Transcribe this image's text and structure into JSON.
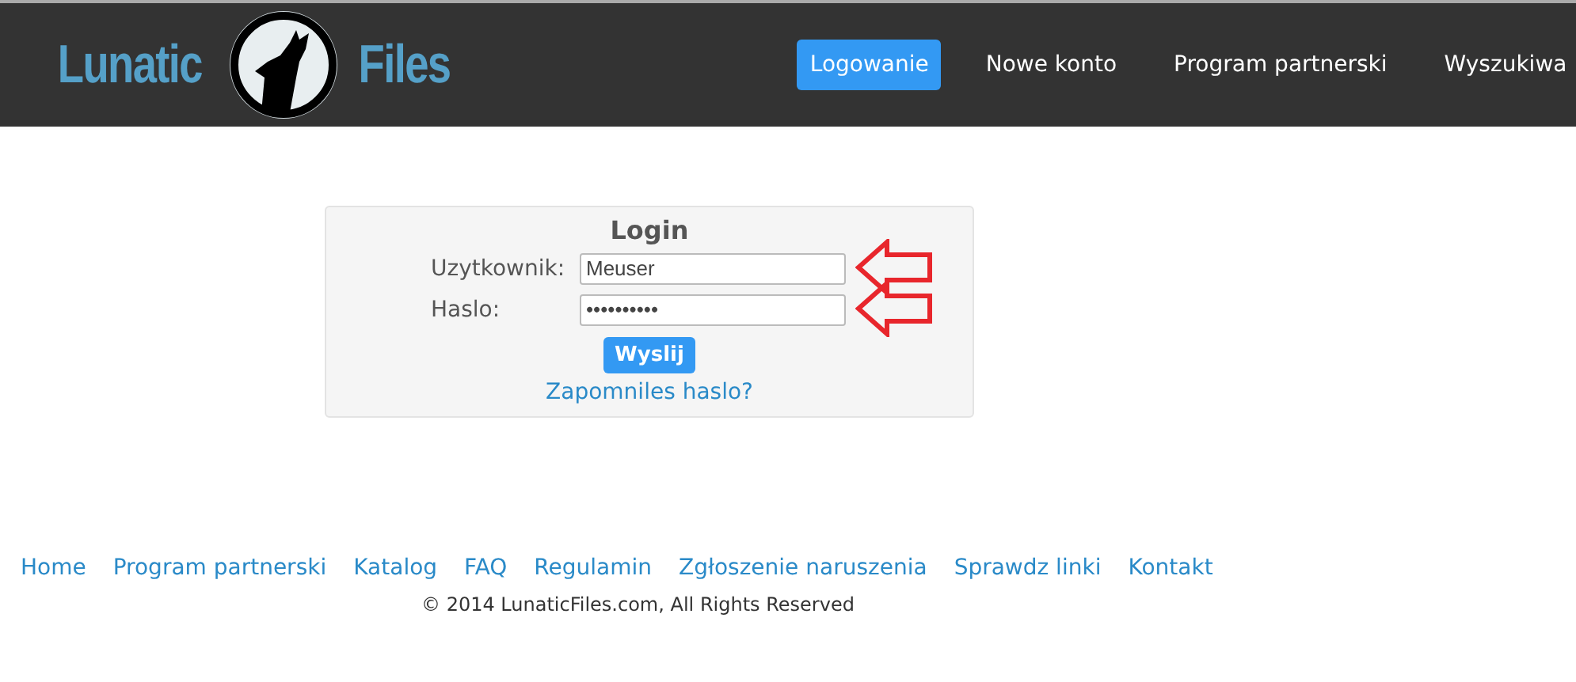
{
  "logo": {
    "left": "Lunatic",
    "right": "Files"
  },
  "nav": [
    {
      "label": "Logowanie",
      "selected": true
    },
    {
      "label": "Nowe konto",
      "selected": false
    },
    {
      "label": "Program partnerski",
      "selected": false
    },
    {
      "label": "Wyszukiwa",
      "selected": false
    }
  ],
  "login": {
    "title": "Login",
    "fields": [
      {
        "label": "Uzytkownik:",
        "value": "Meuser",
        "marked": true
      },
      {
        "label": "Haslo:",
        "value": "••••••••••",
        "marked": true
      }
    ],
    "submit": "Wyslij",
    "forgot": "Zapomniles haslo?"
  },
  "footer": {
    "links": [
      "Home",
      "Program partnerski",
      "Katalog",
      "FAQ",
      "Regulamin",
      "Zgłoszenie naruszenia",
      "Sprawdz linki",
      "Kontakt"
    ],
    "copyright": "© 2014 LunaticFiles.com, All Rights Reserved"
  }
}
